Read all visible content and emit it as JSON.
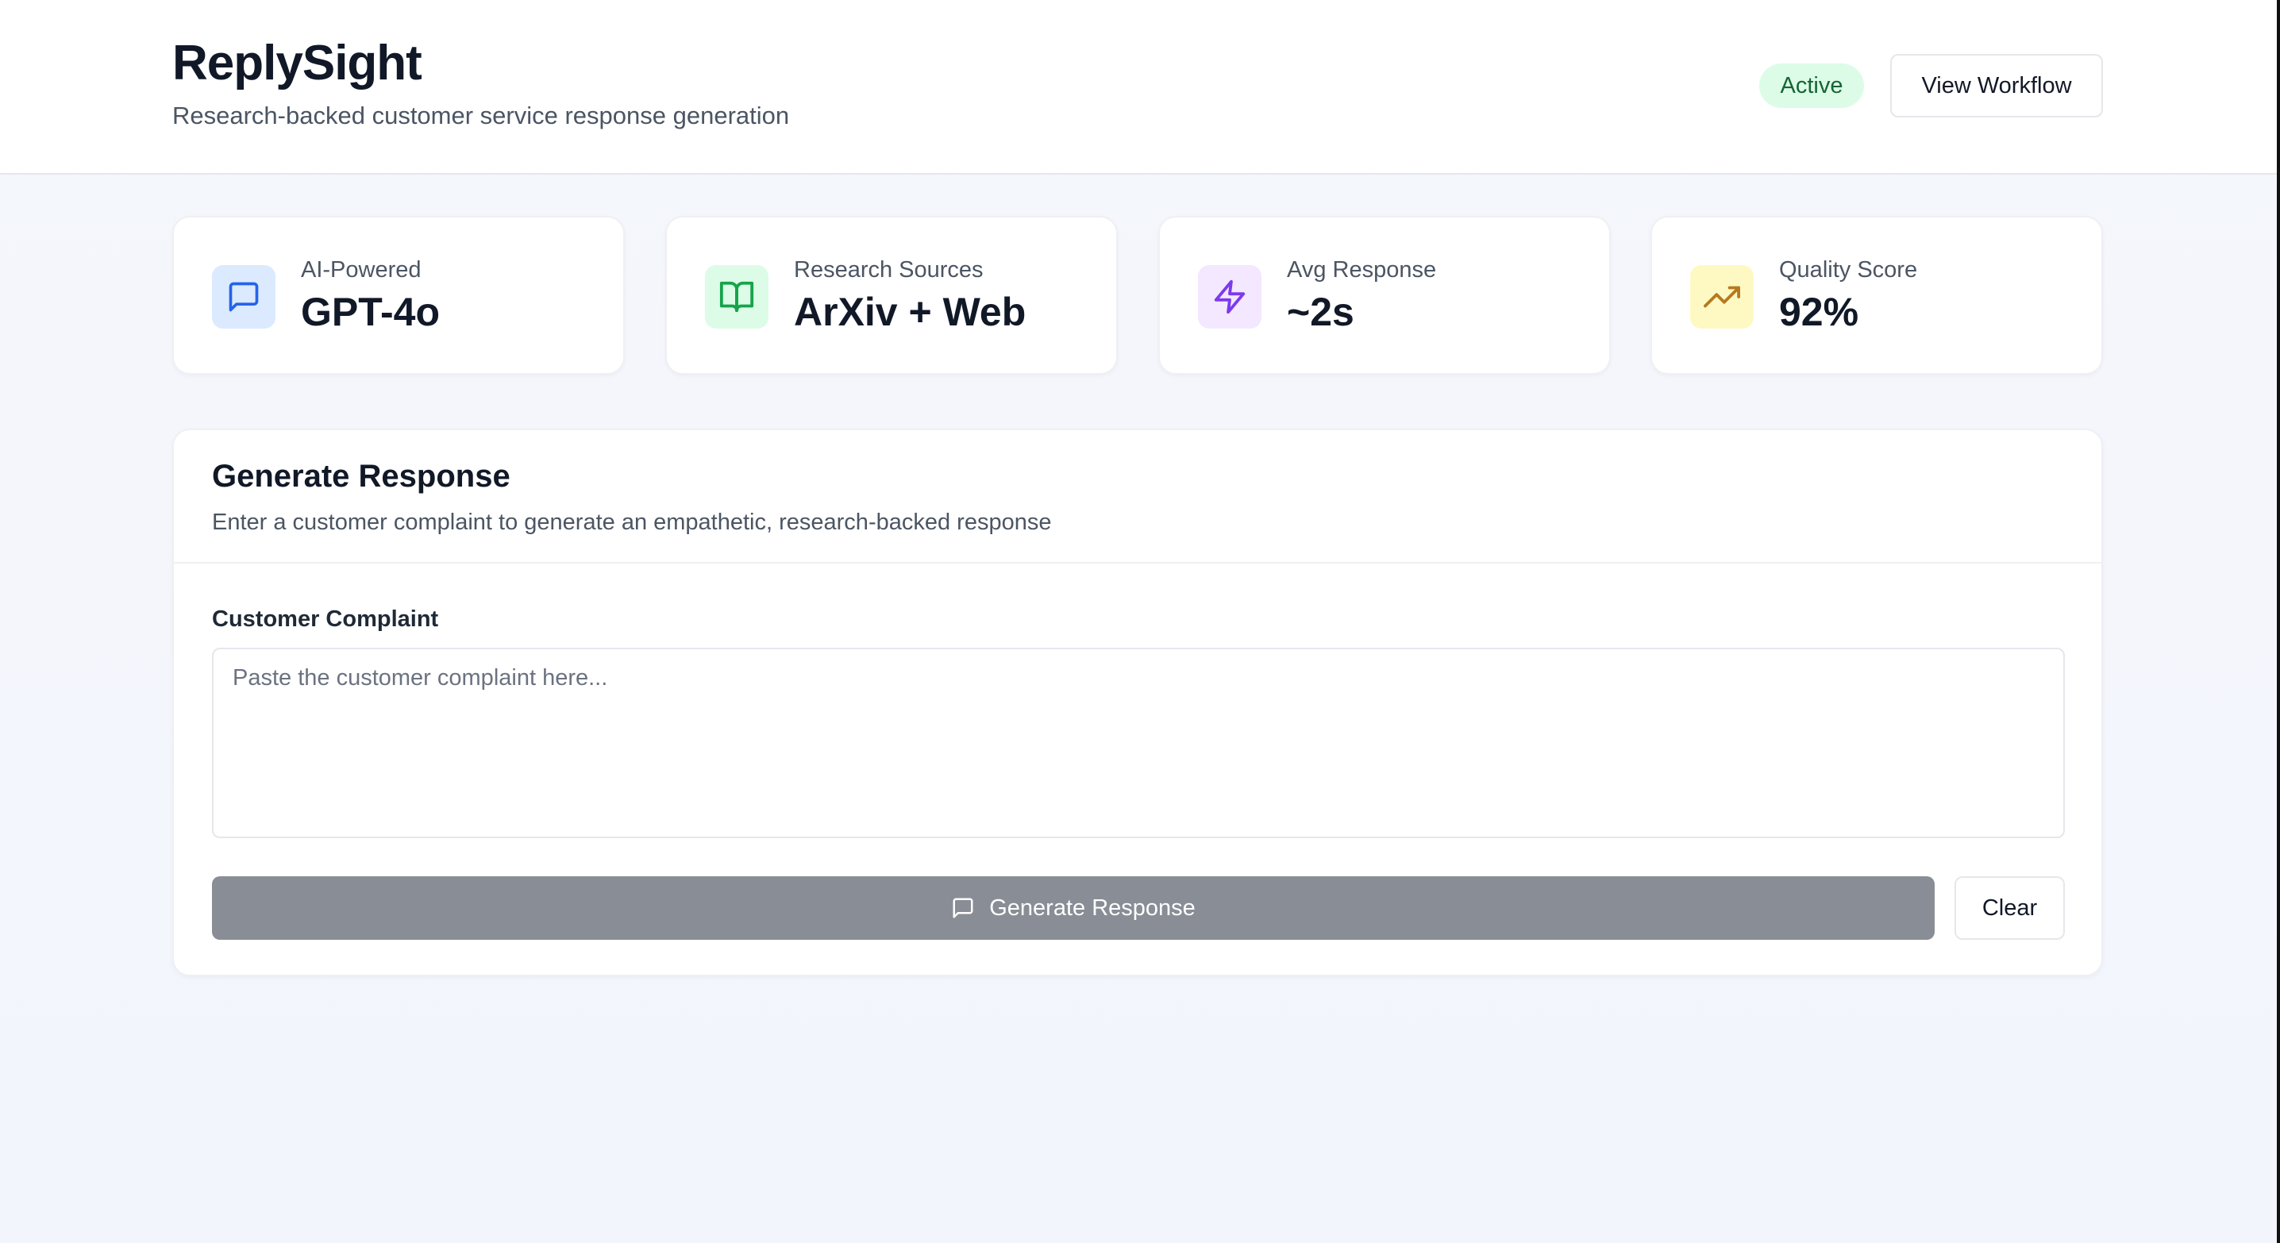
{
  "header": {
    "title": "ReplySight",
    "subtitle": "Research-backed customer service response generation",
    "status_badge": "Active",
    "workflow_button": "View Workflow"
  },
  "stats": [
    {
      "label": "AI-Powered",
      "value": "GPT-4o",
      "icon": "message-square-icon",
      "accent": "#2563eb",
      "icon_bg": "#dbeafe"
    },
    {
      "label": "Research Sources",
      "value": "ArXiv + Web",
      "icon": "book-open-icon",
      "accent": "#16a34a",
      "icon_bg": "#dcfce7"
    },
    {
      "label": "Avg Response",
      "value": "~2s",
      "icon": "zap-icon",
      "accent": "#7c3aed",
      "icon_bg": "#f3e8ff"
    },
    {
      "label": "Quality Score",
      "value": "92%",
      "icon": "trending-up-icon",
      "accent": "#b7791f",
      "icon_bg": "#fef9c3"
    }
  ],
  "form": {
    "title": "Generate Response",
    "subtitle": "Enter a customer complaint to generate an empathetic, research-backed response",
    "field_label": "Customer Complaint",
    "placeholder": "Paste the customer complaint here...",
    "value": "",
    "generate_label": "Generate Response",
    "clear_label": "Clear"
  },
  "colors": {
    "badge_bg": "#dcfce7",
    "badge_text": "#166534",
    "generate_disabled": "#898d96"
  }
}
